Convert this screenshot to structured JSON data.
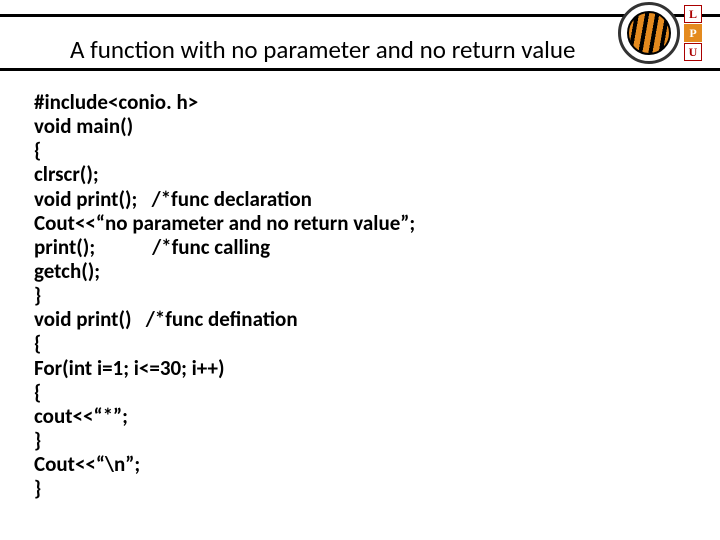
{
  "title": "A function with no parameter and no return value",
  "logo": {
    "letters": [
      "L",
      "P",
      "U"
    ]
  },
  "code_lines": [
    "#include<conio. h>",
    "void main()",
    "{",
    "clrscr();",
    "void print();   /*func declaration",
    "Cout<<“no parameter and no return value”;",
    "print();            /*func calling",
    "getch();",
    "}",
    "void print()   /*func defination",
    "{",
    "For(int i=1; i<=30; i++)",
    "{",
    "cout<<“*”;",
    "}",
    "Cout<<“\\n”;",
    "}"
  ]
}
